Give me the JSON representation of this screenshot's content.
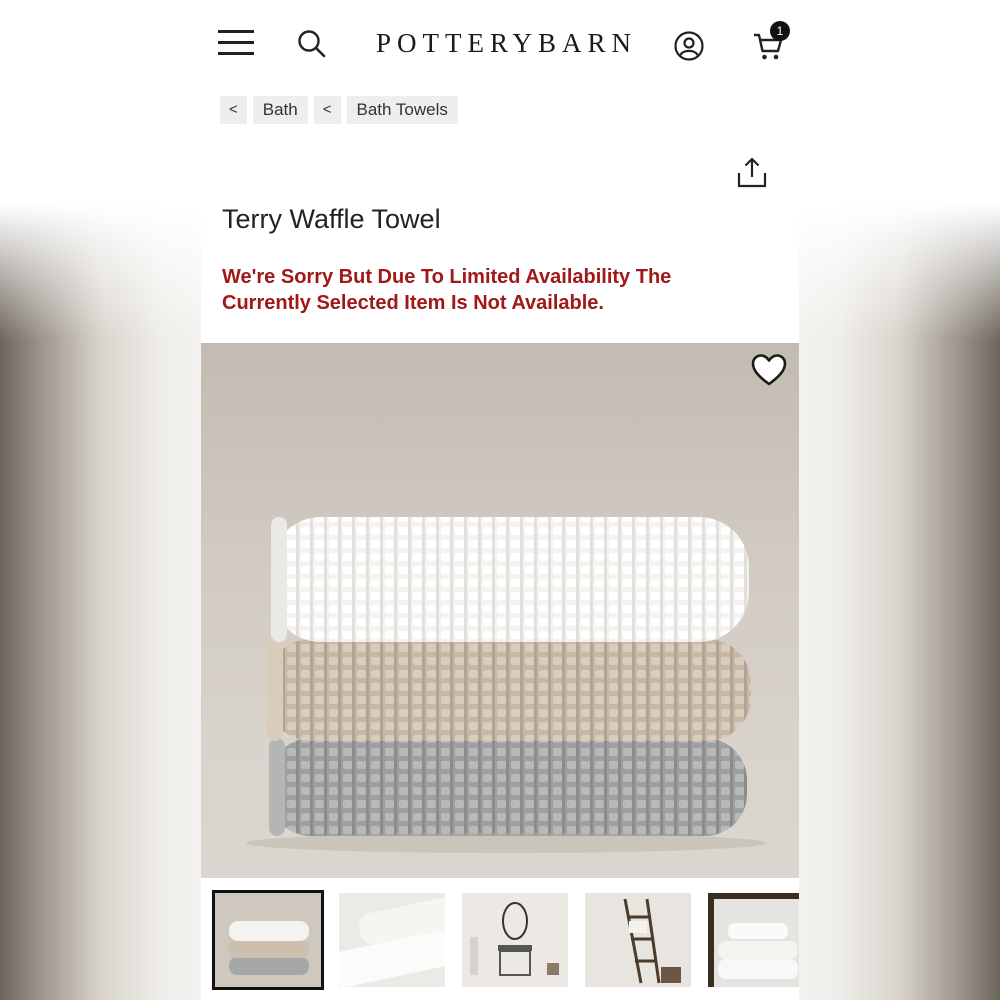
{
  "header": {
    "logo": "POTTERYBARN",
    "cart_count": "1"
  },
  "icons": {
    "menu": "hamburger-menu-icon",
    "search": "search-icon",
    "account": "account-icon",
    "cart": "cart-icon",
    "share": "share-icon",
    "favorite": "heart-icon"
  },
  "breadcrumb": {
    "items": [
      {
        "chevron": "<",
        "label": "Bath"
      },
      {
        "chevron": "<",
        "label": "Bath Towels"
      }
    ]
  },
  "product": {
    "title": "Terry Waffle Towel",
    "availability_notice": "We're Sorry But Due To Limited Availability The Currently Selected Item Is Not Available."
  },
  "colors": {
    "notice": "#a01818",
    "towel_white": "#f4f3f0",
    "towel_sand": "#cdbfad",
    "towel_gray": "#a6a8a8"
  },
  "thumbnails": {
    "selected_index": 0,
    "count": 5
  }
}
